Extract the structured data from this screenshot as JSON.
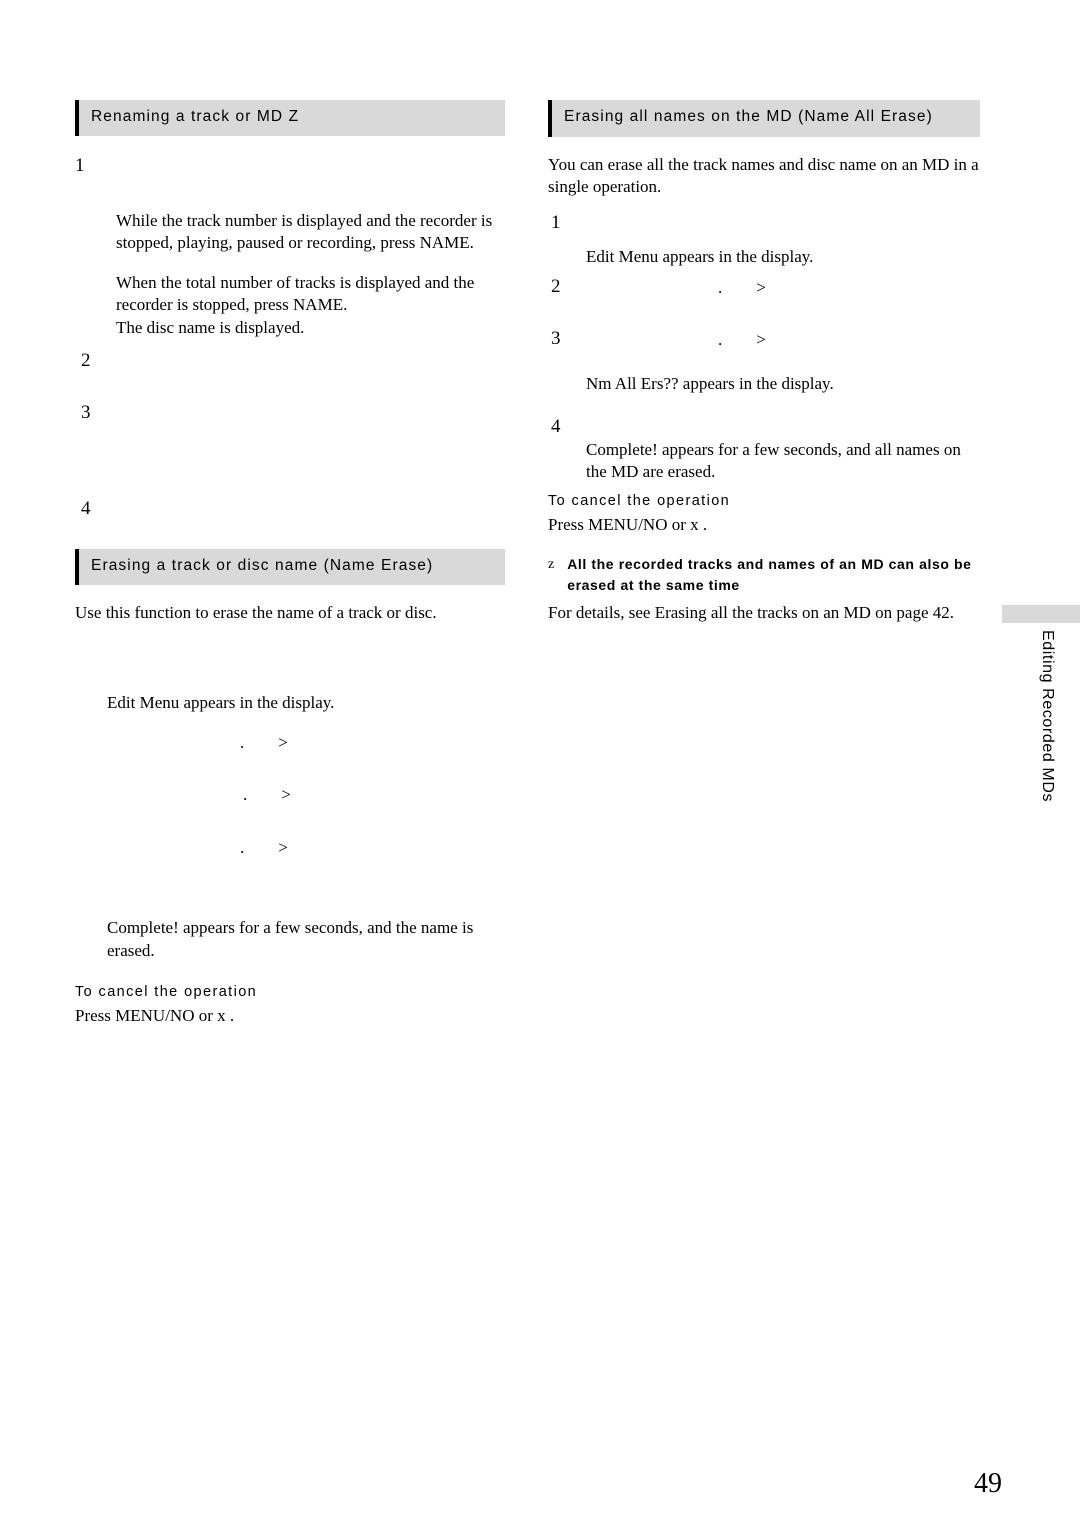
{
  "page": {
    "number": "49",
    "side_tab_label": "Editing Recorded MDs"
  },
  "left_column": {
    "section1": {
      "heading": "Renaming a track or MD Z",
      "steps": [
        {
          "num": "1",
          "paragraphs": [
            "While the track number is displayed and the recorder is stopped, playing, paused or recording, press NAME.",
            "When the total number of tracks is displayed and the recorder is stopped, press NAME.\nThe disc name is displayed."
          ]
        },
        {
          "num": "2",
          "paragraphs": []
        },
        {
          "num": "3",
          "paragraphs": []
        },
        {
          "num": "4",
          "paragraphs": []
        }
      ]
    },
    "section2": {
      "heading": "Erasing a track or disc name (Name Erase)",
      "intro": "Use this function to erase the name of a track or disc.",
      "step1_text": "Edit Menu  appears in the display.",
      "markers": [
        ".        >",
        ".        >",
        ".        >"
      ],
      "result": "Complete!  appears for a few seconds, and the name is erased.",
      "cancel_head": "To cancel the operation",
      "cancel_text": "Press MENU/NO or x ."
    }
  },
  "right_column": {
    "section1": {
      "heading": "Erasing all names on the MD (Name All Erase)",
      "intro": "You can erase all the track names and disc name on an MD in a single operation.",
      "steps": [
        {
          "num": "1",
          "text": "Edit Menu  appears in the display."
        },
        {
          "num": "2",
          "marker": ".        >"
        },
        {
          "num": "3",
          "marker": ".        >",
          "text": "Nm All Ers??  appears in the display."
        },
        {
          "num": "4",
          "text": "Complete!  appears for a few seconds, and all names on the MD are erased."
        }
      ],
      "cancel_head": "To cancel the operation",
      "cancel_text": "Press MENU/NO or x .",
      "note": {
        "bullet": "z",
        "bold_line1": "All the recorded tracks and names of an MD can also be",
        "bold_line2": "erased at the same time",
        "body": "For details, see  Erasing all the tracks on an MD  on page 42."
      }
    }
  }
}
